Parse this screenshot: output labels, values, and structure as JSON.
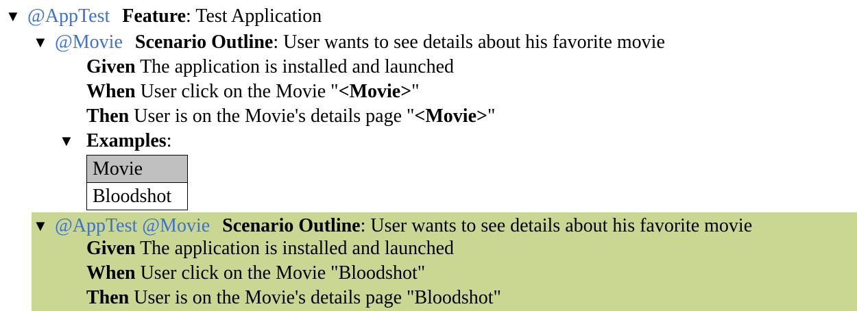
{
  "feature": {
    "tag": "@AppTest",
    "keyword": "Feature",
    "name": "Test Application"
  },
  "outline": {
    "tag": "@Movie",
    "keyword": "Scenario Outline",
    "name": "User wants to see details about his favorite movie",
    "steps": [
      {
        "keyword": "Given",
        "text": "The application is installed and launched"
      },
      {
        "keyword": "When",
        "text": "User click on the Movie \""
      },
      {
        "keyword": "Then",
        "text": "User is on the Movie's details page \""
      }
    ],
    "placeholder": "<Movie>",
    "examples": {
      "keyword": "Examples",
      "header": "Movie",
      "rows": [
        "Bloodshot"
      ]
    }
  },
  "result": {
    "tags": "@AppTest @Movie",
    "keyword": "Scenario Outline",
    "name": "User wants to see details about his favorite movie",
    "steps": [
      {
        "keyword": "Given",
        "text": "The application is installed and launched"
      },
      {
        "keyword": "When",
        "text": "User click on the Movie \"Bloodshot\""
      },
      {
        "keyword": "Then",
        "text": "User is on the Movie's details page \"Bloodshot\""
      }
    ],
    "background_color": "#c9d793"
  },
  "colors": {
    "tag": "#3b73d0",
    "table_header": "#c0c0c0"
  },
  "icons": {
    "caret": "▼"
  }
}
